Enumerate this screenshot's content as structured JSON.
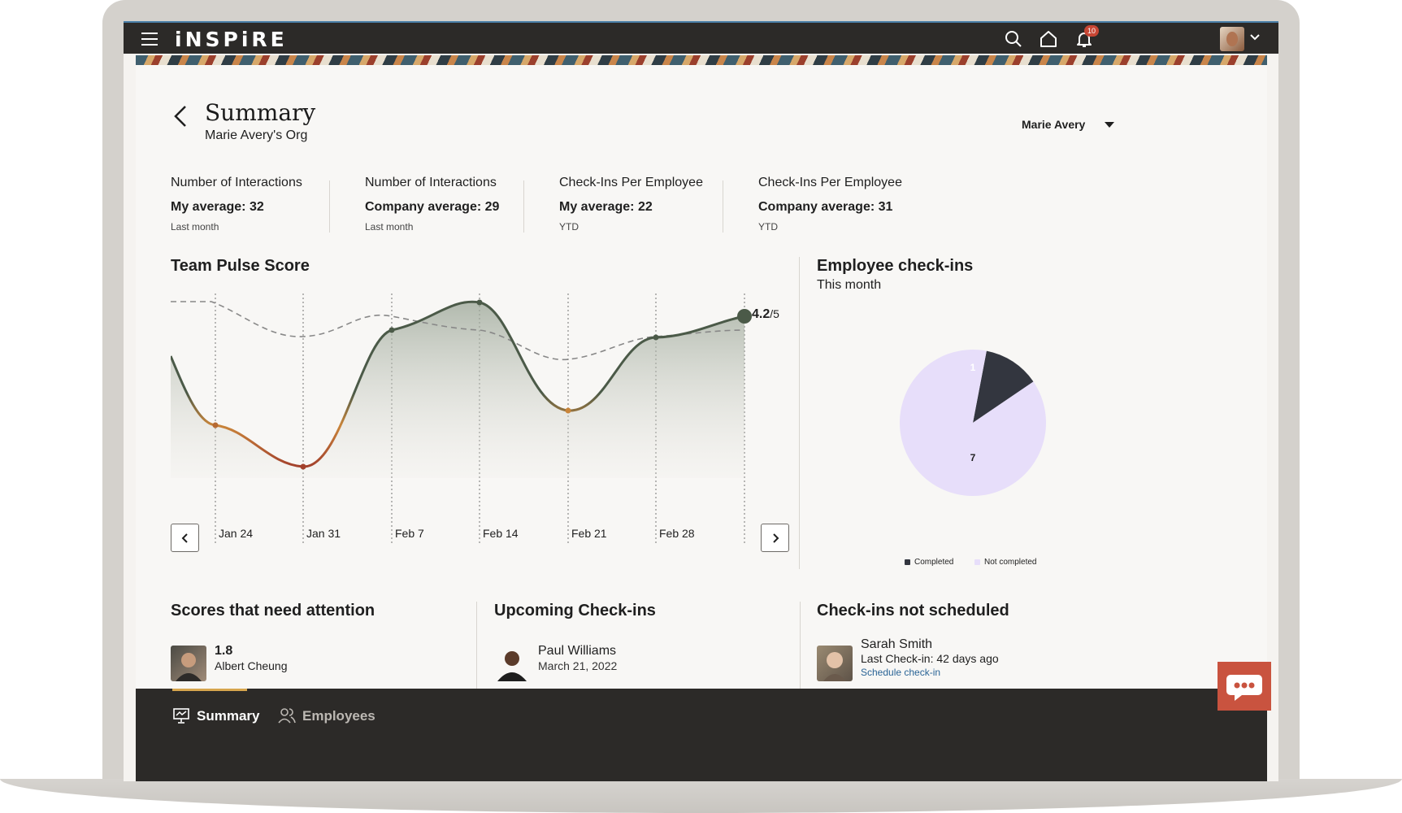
{
  "app": {
    "logo": "iNSPiRE",
    "notifications_count": "10"
  },
  "header": {
    "title": "Summary",
    "subtitle": "Marie Avery's Org",
    "user_select": "Marie Avery"
  },
  "metrics": [
    {
      "title": "Number of Interactions",
      "value": "My average: 32",
      "period": "Last month"
    },
    {
      "title": "Number of Interactions",
      "value": "Company average: 29",
      "period": "Last month"
    },
    {
      "title": "Check-Ins Per Employee",
      "value": "My average: 22",
      "period": "YTD"
    },
    {
      "title": "Check-Ins Per Employee",
      "value": "Company average: 31",
      "period": "YTD"
    }
  ],
  "pulse": {
    "title": "Team Pulse Score",
    "score_value": "4.2",
    "score_suffix": "/5",
    "x_labels": [
      "Jan 24",
      "Jan 31",
      "Feb 7",
      "Feb 14",
      "Feb 21",
      "Feb 28"
    ]
  },
  "checkins": {
    "title": "Employee check-ins",
    "subtitle": "This month",
    "legend_completed": "Completed",
    "legend_not_completed": "Not completed",
    "completed_label": "1",
    "not_completed_label": "7",
    "colors": {
      "completed": "#33363f",
      "not_completed": "#e7defa"
    }
  },
  "chart_data": {
    "type": "pie",
    "title": "Employee check-ins",
    "subtitle": "This month",
    "categories": [
      "Completed",
      "Not completed"
    ],
    "values": [
      1,
      7
    ]
  },
  "attention": {
    "title": "Scores that need attention",
    "score": "1.8",
    "name": "Albert Cheung"
  },
  "upcoming": {
    "title": "Upcoming Check-ins",
    "name": "Paul Williams",
    "date": "March 21, 2022"
  },
  "not_scheduled": {
    "title": "Check-ins not scheduled",
    "name": "Sarah Smith",
    "detail": "Last Check-in: 42 days ago",
    "link": "Schedule check-in"
  },
  "bottom_nav": {
    "summary": "Summary",
    "employees": "Employees"
  },
  "colors": {
    "accent": "#d7a64e",
    "topbar": "#2c2a28",
    "chat": "#c9533f",
    "line": "#4b5a48"
  }
}
